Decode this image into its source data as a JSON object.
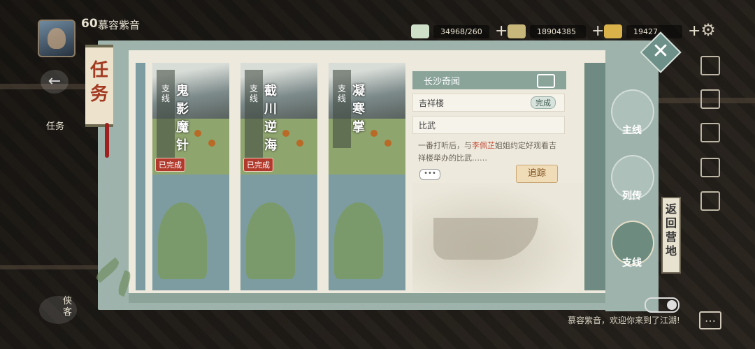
{
  "player": {
    "level": "60",
    "name": "慕容紫音"
  },
  "resources": [
    {
      "icon": "jade-coin-icon",
      "value": "34968/260",
      "color": "#cfe0c8"
    },
    {
      "icon": "silver-ingot-icon",
      "value": "18904385",
      "color": "#c8b77a"
    },
    {
      "icon": "gold-ingot-icon",
      "value": "19427",
      "color": "#d9b24a"
    }
  ],
  "panel_title": "任务",
  "side_task_label": "任务",
  "side_knight_label": "侠客",
  "quest_cards": [
    {
      "tag": "支线",
      "name": "鬼影魔针",
      "status": "已完成"
    },
    {
      "tag": "支线",
      "name": "截川逆海",
      "status": "已完成"
    },
    {
      "tag": "支线",
      "name": "凝寒掌",
      "status": ""
    }
  ],
  "detail": {
    "region": "长沙奇闻",
    "step1": "吉祥楼",
    "step1_status": "完成",
    "step2": "比武",
    "desc_before": "一番打听后，与",
    "desc_highlight": "李佩芷",
    "desc_after": "姐姐约定好观看吉祥楼举办的比武……",
    "more": "•••",
    "track_button": "追踪"
  },
  "tabs": [
    {
      "label": "主线",
      "active": false
    },
    {
      "label": "列传",
      "active": false
    },
    {
      "label": "支线",
      "active": true
    }
  ],
  "close_symbol": "✕",
  "camp_label": "返回营地",
  "welcome_message": "慕容紫音，欢迎你来到了江湖!",
  "colors": {
    "accent": "#9db3ab",
    "highlight": "#c24c3a",
    "done_badge": "#b23a2c"
  }
}
